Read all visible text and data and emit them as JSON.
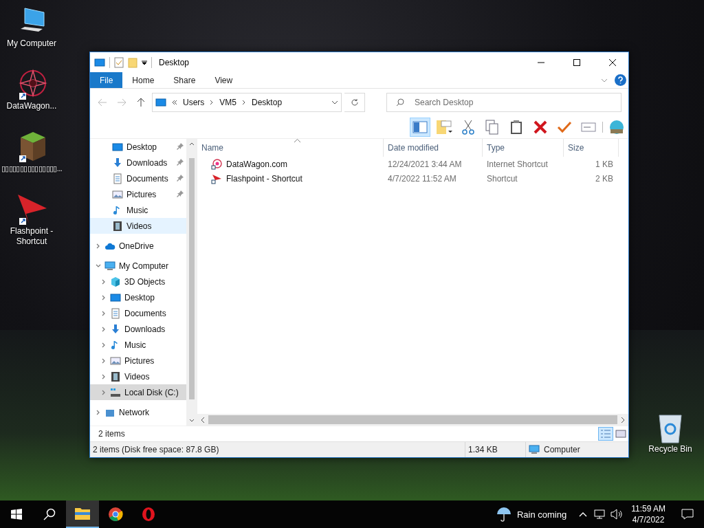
{
  "desktop": {
    "icons": [
      {
        "label": "My Computer",
        "kind": "computer",
        "shortcut": false
      },
      {
        "label": "DataWagon...",
        "kind": "web",
        "shortcut": true
      },
      {
        "label": "▯▯▯▯▯▯▯▯▯▯▯▯▯▯▯...",
        "kind": "block",
        "shortcut": true
      },
      {
        "label": "Flashpoint - Shortcut",
        "kind": "flash",
        "shortcut": true
      }
    ],
    "recycle_bin": {
      "label": "Recycle Bin"
    }
  },
  "window": {
    "title": "Desktop",
    "ribbon_tabs": [
      {
        "label": "File",
        "selected": true
      },
      {
        "label": "Home",
        "selected": false
      },
      {
        "label": "Share",
        "selected": false
      },
      {
        "label": "View",
        "selected": false
      }
    ],
    "address": {
      "path": [
        "Users",
        "VM5",
        "Desktop"
      ]
    },
    "search": {
      "placeholder": "Search Desktop"
    },
    "navigation": {
      "quick_access": [
        {
          "label": "Desktop",
          "kind": "desktop",
          "pinned": true,
          "selected": false
        },
        {
          "label": "Downloads",
          "kind": "downloads",
          "pinned": true,
          "selected": false
        },
        {
          "label": "Documents",
          "kind": "documents",
          "pinned": true,
          "selected": false
        },
        {
          "label": "Pictures",
          "kind": "pictures",
          "pinned": true,
          "selected": false
        },
        {
          "label": "Music",
          "kind": "music",
          "pinned": false,
          "selected": false
        },
        {
          "label": "Videos",
          "kind": "videos",
          "pinned": false,
          "selected": true
        }
      ],
      "tree": [
        {
          "label": "OneDrive",
          "kind": "cloud",
          "expanded": false,
          "selected": false
        },
        {
          "label": "My Computer",
          "kind": "computer",
          "expanded": true,
          "selected": false,
          "children": [
            {
              "label": "3D Objects",
              "kind": "cube",
              "expanded": false,
              "selected": false
            },
            {
              "label": "Desktop",
              "kind": "desktop",
              "expanded": false,
              "selected": false
            },
            {
              "label": "Documents",
              "kind": "documents",
              "expanded": false,
              "selected": false
            },
            {
              "label": "Downloads",
              "kind": "downloads",
              "expanded": false,
              "selected": false
            },
            {
              "label": "Music",
              "kind": "music",
              "expanded": false,
              "selected": false
            },
            {
              "label": "Pictures",
              "kind": "pictures",
              "expanded": false,
              "selected": false
            },
            {
              "label": "Videos",
              "kind": "videos",
              "expanded": false,
              "selected": false
            },
            {
              "label": "Local Disk (C:)",
              "kind": "disk",
              "expanded": false,
              "selected": true
            }
          ]
        },
        {
          "label": "Network",
          "kind": "network",
          "expanded": false,
          "selected": false
        }
      ]
    },
    "files": {
      "columns": [
        "Name",
        "Date modified",
        "Type",
        "Size"
      ],
      "rows": [
        {
          "name": "DataWagon.com",
          "date_modified": "12/24/2021 3:44 AM",
          "type": "Internet Shortcut",
          "size": "1 KB",
          "kind": "web",
          "selected": false
        },
        {
          "name": "Flashpoint - Shortcut",
          "date_modified": "4/7/2022 11:52 AM",
          "type": "Shortcut",
          "size": "2 KB",
          "kind": "flash",
          "selected": false
        }
      ]
    },
    "item_count": "2 items",
    "view_modes": [
      {
        "kind": "details",
        "selected": true
      },
      {
        "kind": "large",
        "selected": false
      }
    ],
    "status_bar": {
      "summary": "2 items (Disk free space: 87.8 GB)",
      "size": "1.34 KB",
      "location": "Computer"
    }
  },
  "taskbar": {
    "apps": [
      {
        "kind": "explorer",
        "active": true
      },
      {
        "kind": "chrome",
        "active": false
      },
      {
        "kind": "opera",
        "active": false
      }
    ],
    "weather": "Rain coming",
    "time": "11:59 AM",
    "date": "4/7/2022"
  }
}
